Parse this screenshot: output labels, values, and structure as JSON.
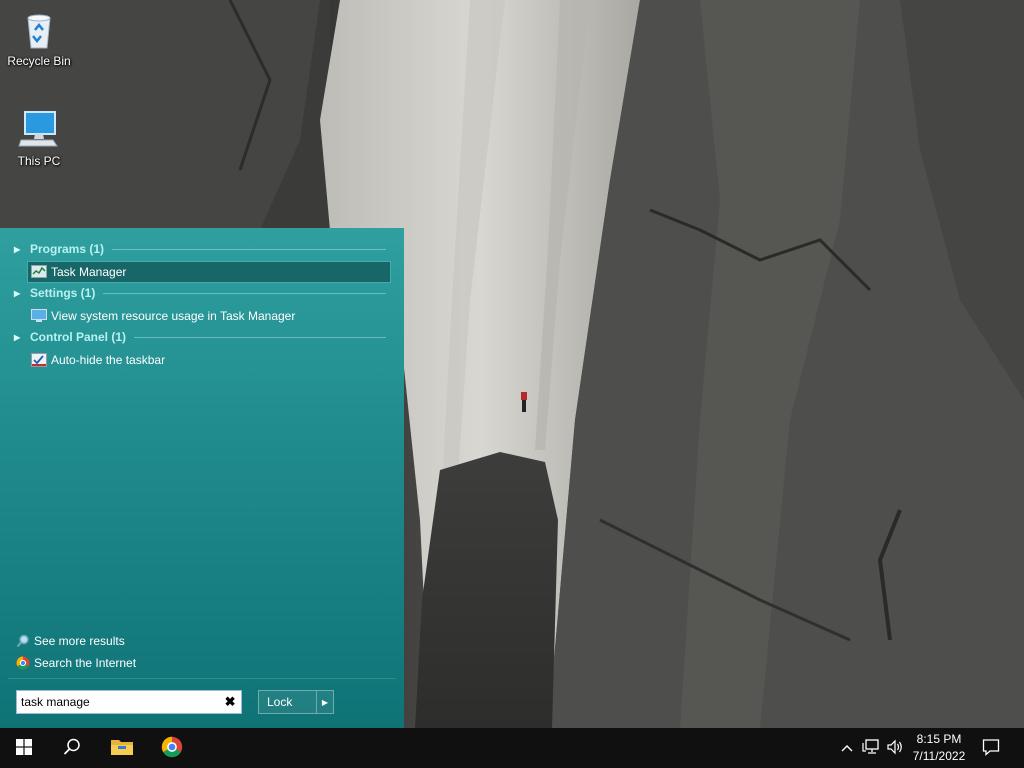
{
  "desktop": {
    "icons": [
      {
        "label": "Recycle Bin",
        "icon": "recycle-bin-icon"
      },
      {
        "label": "This PC",
        "icon": "computer-icon"
      }
    ]
  },
  "start_panel": {
    "groups": [
      {
        "header": "Programs (1)",
        "items": [
          {
            "label": "Task Manager",
            "icon": "task-manager-icon",
            "selected": true
          }
        ]
      },
      {
        "header": "Settings (1)",
        "items": [
          {
            "label": "View system resource usage in Task Manager",
            "icon": "monitor-settings-icon"
          }
        ]
      },
      {
        "header": "Control Panel (1)",
        "items": [
          {
            "label": "Auto-hide the taskbar",
            "icon": "taskbar-settings-icon"
          }
        ]
      }
    ],
    "see_more": "See more results",
    "search_internet": "Search the Internet",
    "search_value": "task manage",
    "lock_label": "Lock"
  },
  "taskbar": {
    "apps": [
      "windows-start-icon",
      "search-icon",
      "file-explorer-icon",
      "chrome-icon"
    ],
    "tray": [
      "chevron-up-icon",
      "network-icon",
      "volume-icon"
    ],
    "time": "8:15 PM",
    "date": "7/11/2022"
  },
  "colors": {
    "panel_top": "#2f9f9f",
    "panel_bottom": "#0f7376",
    "taskbar": "#101010",
    "group_header": "#b9f1f2"
  }
}
